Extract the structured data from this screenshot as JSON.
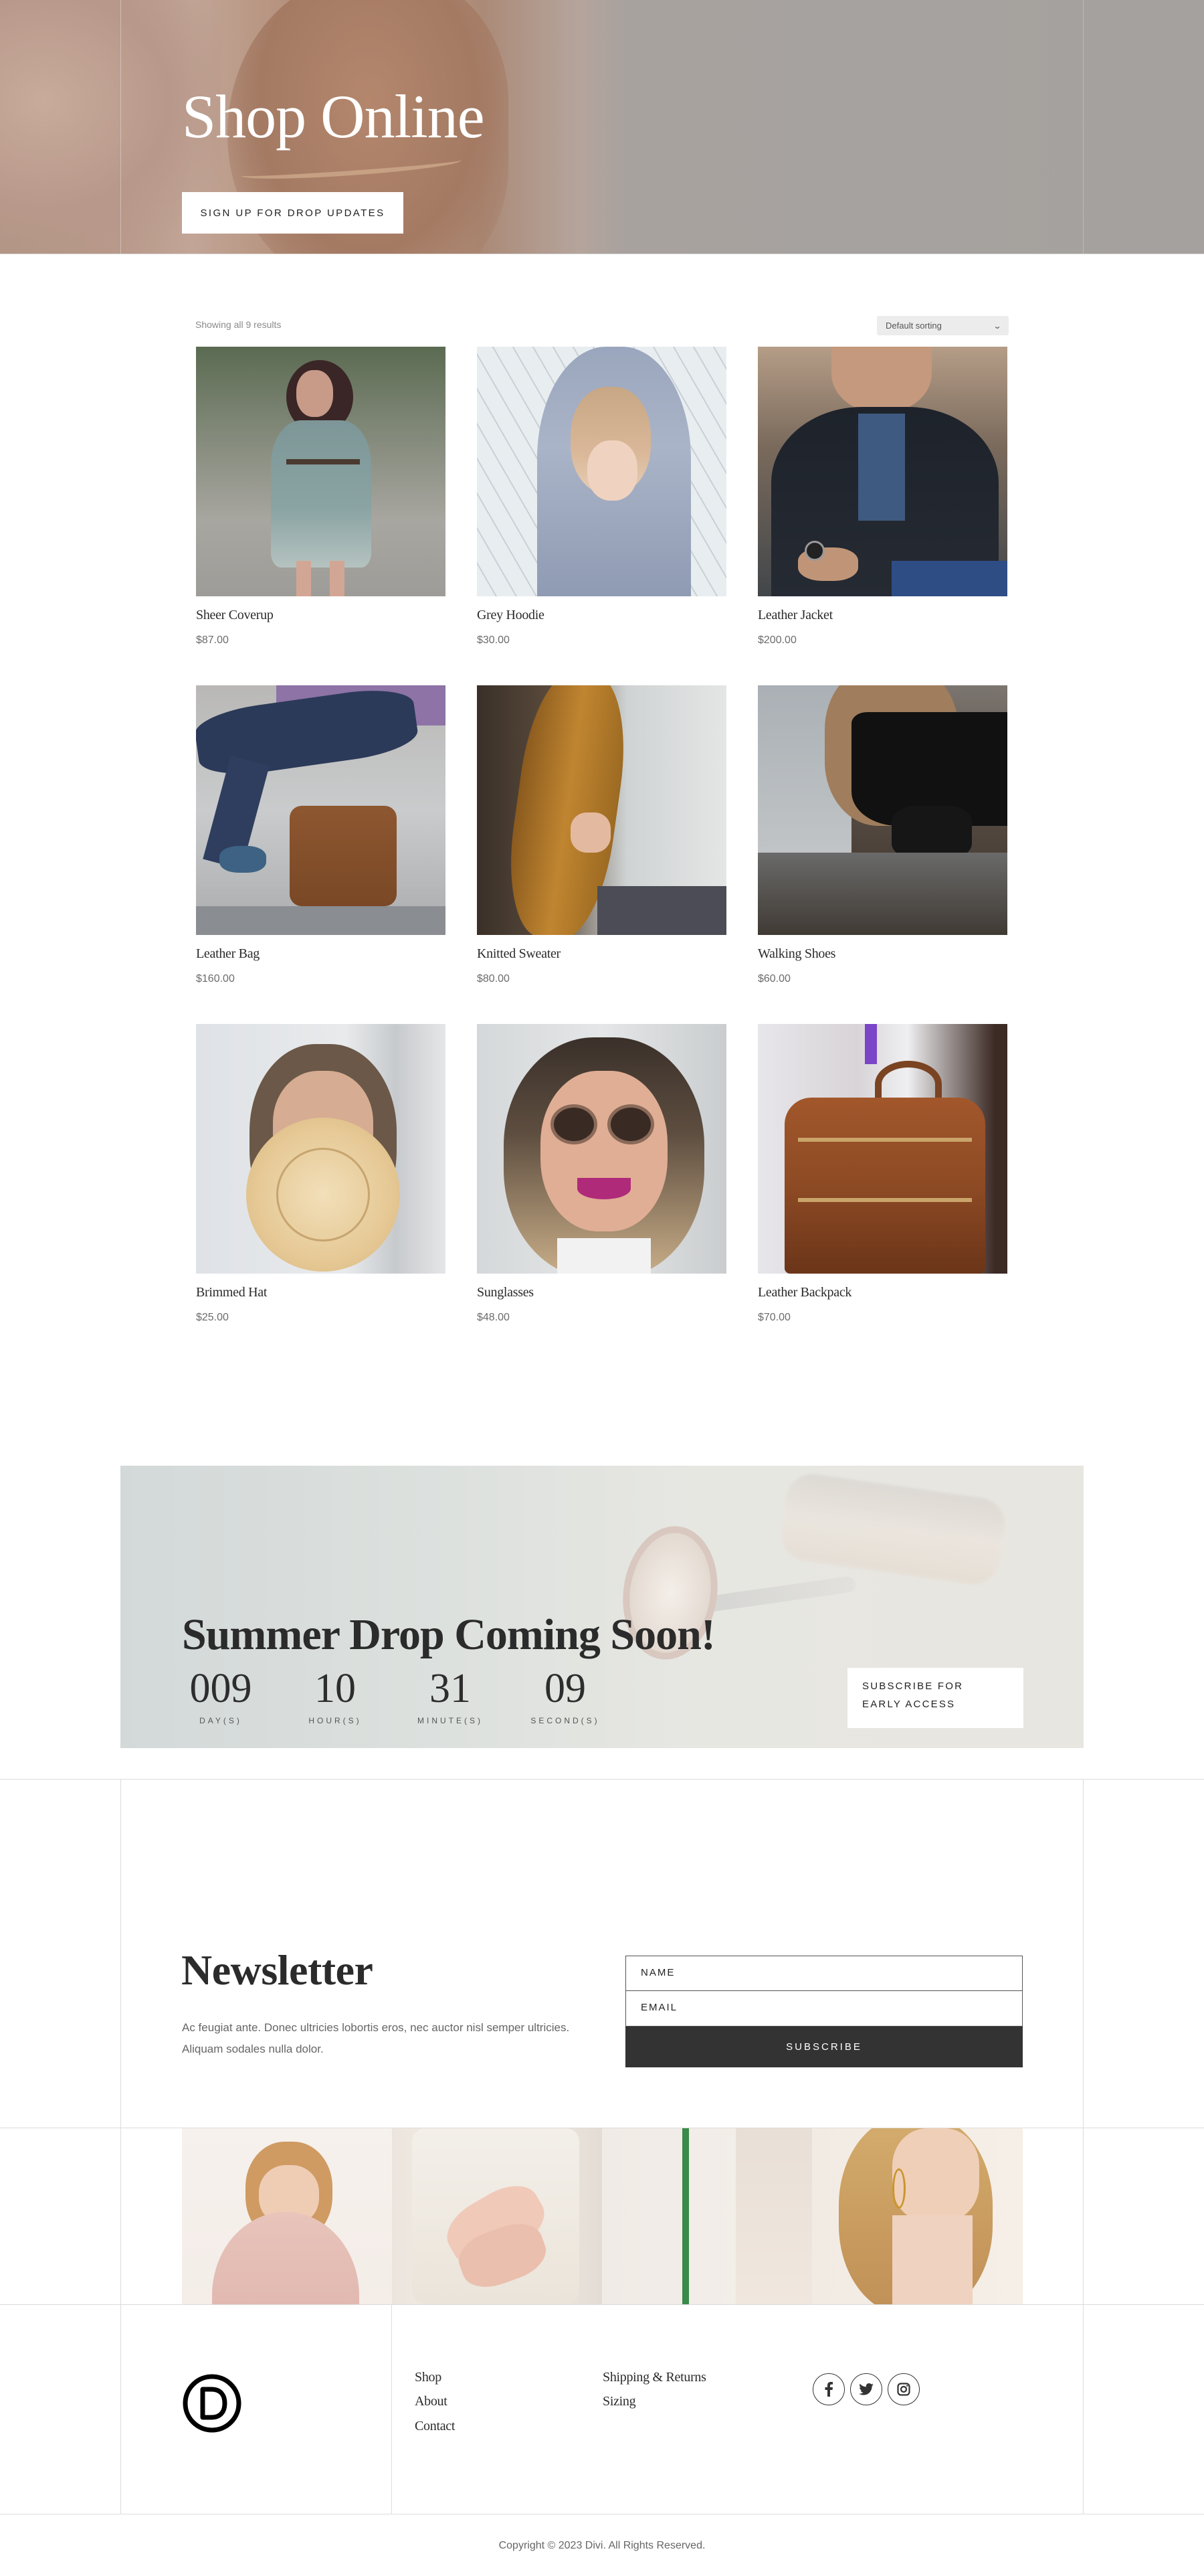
{
  "hero": {
    "title": "Shop Online",
    "button_label": "SIGN UP FOR DROP UPDATES"
  },
  "shop": {
    "result_count": "Showing all 9 results",
    "sort": {
      "selected": "Default sorting",
      "icon": "chevron-down-icon"
    },
    "products": [
      {
        "name": "Sheer Coverup",
        "price": "$87.00"
      },
      {
        "name": "Grey Hoodie",
        "price": "$30.00"
      },
      {
        "name": "Leather Jacket",
        "price": "$200.00"
      },
      {
        "name": "Leather Bag",
        "price": "$160.00"
      },
      {
        "name": "Knitted Sweater",
        "price": "$80.00"
      },
      {
        "name": "Walking Shoes",
        "price": "$60.00"
      },
      {
        "name": "Brimmed Hat",
        "price": "$25.00"
      },
      {
        "name": "Sunglasses",
        "price": "$48.00"
      },
      {
        "name": "Leather Backpack",
        "price": "$70.00"
      }
    ]
  },
  "countdown": {
    "title": "Summer Drop Coming Soon!",
    "units": [
      {
        "value": "009",
        "label": "DAY(S)"
      },
      {
        "value": "10",
        "label": "HOUR(S)"
      },
      {
        "value": "31",
        "label": "MINUTE(S)"
      },
      {
        "value": "09",
        "label": "SECOND(S)"
      }
    ],
    "button_label": "SUBSCRIBE FOR EARLY ACCESS"
  },
  "newsletter": {
    "title": "Newsletter",
    "text": "Ac feugiat ante. Donec ultricies lobortis eros, nec auctor nisl semper ultricies. Aliquam sodales nulla dolor.",
    "name_placeholder": "NAME",
    "email_placeholder": "EMAIL",
    "submit_label": "SUBSCRIBE"
  },
  "gallery": {
    "images": [
      "woman-with-pink-hat",
      "hands-with-rings",
      "palm-leaf",
      "woman-with-gold-earring"
    ]
  },
  "footer": {
    "logo": "divi-logo",
    "links_col1": [
      "Shop",
      "About",
      "Contact"
    ],
    "links_col2": [
      "Shipping & Returns",
      "Sizing"
    ],
    "social": [
      {
        "name": "facebook",
        "icon": "facebook-icon"
      },
      {
        "name": "twitter",
        "icon": "twitter-icon"
      },
      {
        "name": "instagram",
        "icon": "instagram-icon"
      }
    ],
    "copyright": "Copyright © 2023 Divi. All Rights Reserved."
  },
  "colors": {
    "text_dark": "#2b2b2b",
    "button_dark": "#333333",
    "muted": "#666666",
    "divider": "#dcdcdc"
  }
}
